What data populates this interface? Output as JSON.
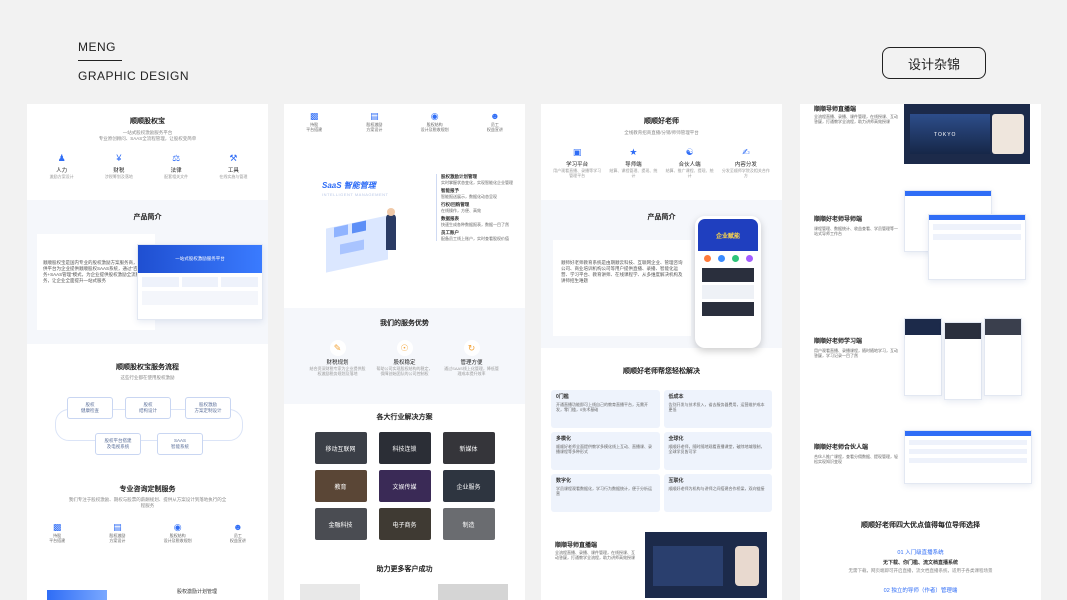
{
  "brand": {
    "line1": "MENG",
    "line2": "GRAPHIC DESIGN"
  },
  "tag_button": "设计杂锦",
  "colors": {
    "accent": "#2f6df6",
    "background": "#f2f2f2"
  },
  "panel1": {
    "title": "顺顺股权宝",
    "subtitle": "一站式股权激励服务平台",
    "desc": "专业原创顾问、SAAS全流程管理，让股权变简单",
    "features": [
      {
        "icon": "person-icon",
        "name": "人力",
        "desc": "激励方案设计"
      },
      {
        "icon": "yen-icon",
        "name": "财税",
        "desc": "涉税筹划及落地"
      },
      {
        "icon": "gavel-icon",
        "name": "法律",
        "desc": "配套相关文件"
      },
      {
        "icon": "tools-icon",
        "name": "工具",
        "desc": "在线实施与管理"
      }
    ],
    "intro_title": "产品简介",
    "intro_text": "顺顺股权宝是国内专业的股权激励方案服务商，所提供平台为企业提供顺顺股权SAAS系统，通过“咨询服务+SAAS管理”模式，为企业提供股权激励全流程服务，让企业全面提升一站式服务",
    "mockup_title": "一站式股权激励服务平台",
    "flow_title": "顺顺股权宝服务流程",
    "flow_desc": "这些行业都在使用股权激励",
    "flow_nodes": [
      "股权\n健康检查",
      "股权\n结构设计",
      "股权激励\n方案定制设计",
      "股权平台搭建\n及电视系统",
      "SAAS\n智能系统"
    ],
    "consult_title": "专业咨询定制服务",
    "consult_desc": "我们专注于股权激励、期权与股票的薪酬规划、提供从方案设计到落地执行的全程服务",
    "services": [
      {
        "icon": "platform-icon",
        "name": "持股\n平台搭建"
      },
      {
        "icon": "equity-icon",
        "name": "股权激励\n方案设计"
      },
      {
        "icon": "structure-icon",
        "name": "股权结构\n设计及税收规划"
      },
      {
        "icon": "staff-icon",
        "name": "员工\n权益宣讲"
      }
    ],
    "bottom_label": "股权激励计划管理"
  },
  "panel2": {
    "services": [
      {
        "icon": "platform-icon",
        "name": "持股\n平台搭建"
      },
      {
        "icon": "equity-icon",
        "name": "股权激励\n方案设计"
      },
      {
        "icon": "structure-icon",
        "name": "股权结构\n设计及税收规划"
      },
      {
        "icon": "staff-icon",
        "name": "员工\n权益宣讲"
      }
    ],
    "saas_title": "SaaS 智能管理",
    "saas_sub": "INTELLIGENT MANAGEMENT",
    "saas_items": [
      {
        "t": "股权激励计划管理",
        "d": "实时掌握状态变化，实现智能化企业管理"
      },
      {
        "t": "智能报予",
        "d": "智能报送展示，数据化动态呈现"
      },
      {
        "t": "行权/回购管理",
        "d": "在线操作，方便、高效"
      },
      {
        "t": "数据报表",
        "d": "快速生成各种数据报表，数据一目了然"
      },
      {
        "t": "员工账户",
        "d": "配备员工线上账户，实时查看股权价值"
      }
    ],
    "adv_title": "我们的服务优势",
    "advantages": [
      {
        "icon": "doc-check-icon",
        "name": "财税规划",
        "d": "结合资深财税专家为企业提供股权激励税务规划及落地"
      },
      {
        "icon": "shield-icon",
        "name": "股权稳定",
        "d": "帮助公司实现股权结构的稳定，保障创始团队的公司控制权"
      },
      {
        "icon": "loop-icon",
        "name": "管理方便",
        "d": "通过SAAS线上化管理，降低管理成本提升效率"
      }
    ],
    "industry_title": "各大行业解决方案",
    "industries": [
      "移动互联网",
      "科技连锁",
      "新媒体",
      "教育",
      "文娱传媒",
      "企业服务",
      "金融科技",
      "电子商务",
      "制造"
    ],
    "help_title": "助力更多客户成功"
  },
  "panel3": {
    "title": "顺顺好老师",
    "desc": "全线教育招商直播/分销/师师管理平台",
    "features": [
      {
        "icon": "monitor-icon",
        "name": "学习平台",
        "d": "用户观看直播、录播等学习管理平台"
      },
      {
        "icon": "guide-icon",
        "name": "导师端",
        "d": "结算、课程管理、提现、统计"
      },
      {
        "icon": "partner-icon",
        "name": "合伙人端",
        "d": "结算、推广课程、提现、统计"
      },
      {
        "icon": "share-icon",
        "name": "内容分发",
        "d": "分发至顺师学院及相关合作方"
      }
    ],
    "intro_title": "产品简介",
    "intro_text": "顺师好老师教育系统是由期顺云科技、互联网企业、管理咨询公司、商业培训机构公司等用户提供直播、录播、智能化运营、学习平台、教育讲师、在线课程学、从多维度解决机构及讲师招生难题",
    "phone_banner": "企业赋能",
    "help_title": "顺顺好老师帮您轻松解决",
    "problems": [
      {
        "t": "0门槛",
        "d": "开通直播功能即可上线自己的教育直播平台，无需开发，零门槛，0技术基础"
      },
      {
        "t": "低成本",
        "d": "告别开发与技术投入，省去服务器费用，运营维护成本更低"
      },
      {
        "t": "多模化",
        "d": "顺顺好老师全面提供教学多模化线上互动、直播课、录播课程等多种形式"
      },
      {
        "t": "全球化",
        "d": "顺顺好老师，随时随地观看直播课堂，破除地域限制，全球学员皆可学"
      },
      {
        "t": "数字化",
        "d": "学员课程观看数据化，学习行为数据统计，便于分析运营"
      },
      {
        "t": "互联化",
        "d": "顺顺好老师为机构与讲师之间搭建合作桥梁，双向链接"
      }
    ],
    "live_title": "顺顺导师直播端",
    "live_text": "全流程直播、录播、课件管理，在线授课、互动答疑，打通教学全流程，助力讲师高效授课"
  },
  "panel4": {
    "top_title": "顺顺导师直播端",
    "top_text": "全流程直播、录播、课件管理，在线授课、互动答疑，打通教学全流程，助力讲师高效授课",
    "video_badge": "TOKYO",
    "mentor_title": "顺顺好老师导师端",
    "mentor_text": "课程管理、数据统计、收益查看、学员管理等一站式导师工作台",
    "student_title": "顺顺好老师学习端",
    "student_text": "用户观看直播、录播课程，随时随地学习，互动答疑，学习记录一目了然",
    "partner_title": "顺顺好老师合伙人端",
    "partner_text": "合伙人推广课程，查看分佣数据、提现管理，轻松实现知识变现",
    "bottom_title": "顺顺好老师四大优点值得每位导师选择",
    "point1": "01 入门级直播系统",
    "point1_title": "无下载、你门槛、流文档直播系统",
    "point1_text": "无需下载，网页端即可开启直播，流文档直播系统，适用于各类课程场景",
    "point2": "02 独立的导师（作者）管理端"
  }
}
